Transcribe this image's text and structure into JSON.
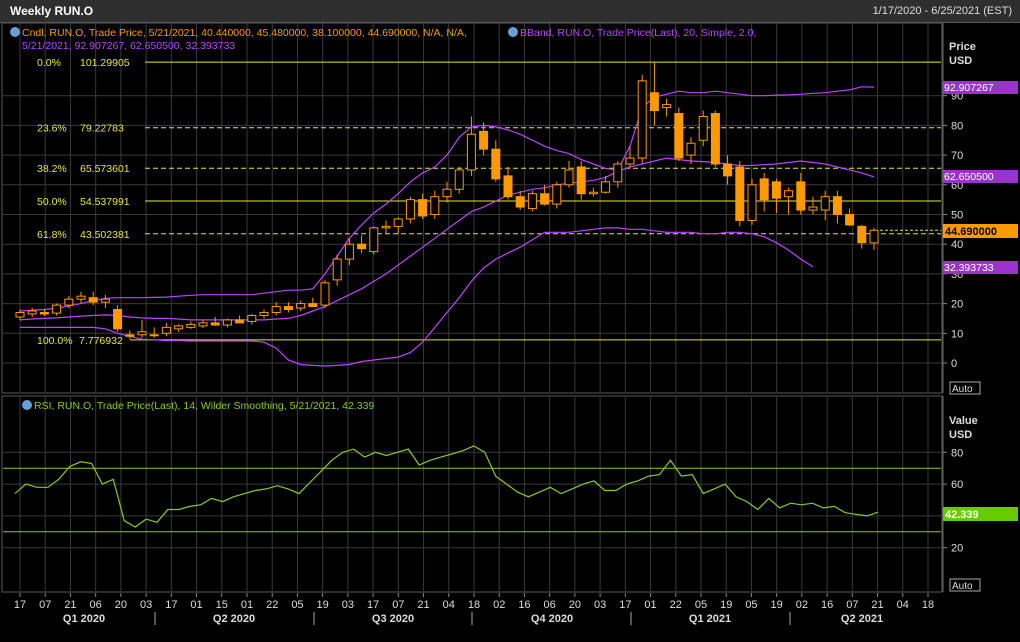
{
  "window": {
    "title": "Weekly RUN.O",
    "date_range": "1/17/2020 - 6/25/2021 (EST)"
  },
  "legend": {
    "candle_line": "Cndl, RUN.O, Trade Price,  5/21/2021, 40.440000, 45.480000, 38.100000, 44.690000, N/A, N/A,",
    "bband_line1": "BBand, RUN.O, Trade Price(Last),  20, Simple, 2.0,",
    "bband_line2": "5/21/2021, 92.907267, 62.650500, 32.393733",
    "rsi_line": "RSI, RUN.O, Trade Price(Last),  14, Wilder Smoothing,  5/21/2021, 42.339"
  },
  "price_axis": {
    "title1": "Price",
    "title2": "USD",
    "auto": "Auto"
  },
  "rsi_axis": {
    "title1": "Value",
    "title2": "USD",
    "auto": "Auto"
  },
  "badges": {
    "bb_upper": "92.907267",
    "bb_mid": "62.650500",
    "last": "44.690000",
    "bb_lower": "32.393733",
    "rsi": "42.339"
  },
  "colors": {
    "background": "#000000",
    "grid": "#3a3a3a",
    "candle": "#ff9900",
    "bband": "#bb44ff",
    "fib": "#e8e830",
    "rsi": "#88cc22"
  },
  "x_axis": {
    "day_ticks": [
      "17",
      "07",
      "21",
      "06",
      "20",
      "03",
      "17",
      "01",
      "15",
      "01",
      "22",
      "05",
      "19",
      "03",
      "17",
      "07",
      "21",
      "04",
      "18",
      "02",
      "16",
      "06",
      "20",
      "03",
      "17",
      "01",
      "22",
      "05",
      "19",
      "05",
      "19",
      "02",
      "16",
      "07",
      "21",
      "04",
      "18"
    ],
    "quarters": [
      "Q1 2020",
      "Q2 2020",
      "Q3 2020",
      "Q4 2020",
      "Q1 2021",
      "Q2 2021"
    ]
  },
  "chart_data": [
    {
      "type": "candlestick",
      "title": "Weekly RUN.O",
      "ylabel": "Price USD",
      "ylim": [
        -5,
        105
      ],
      "yticks": [
        0,
        10,
        20,
        30,
        40,
        50,
        60,
        70,
        80,
        90
      ],
      "fib_levels": [
        {
          "pct": "0.0%",
          "value": "101.29905",
          "v": 101.29905,
          "style": "solid"
        },
        {
          "pct": "23.6%",
          "value": "79.22783",
          "v": 79.22783,
          "style": "dashed"
        },
        {
          "pct": "38.2%",
          "value": "65.573601",
          "v": 65.573601,
          "style": "dashed"
        },
        {
          "pct": "50.0%",
          "value": "54.537991",
          "v": 54.537991,
          "style": "solid"
        },
        {
          "pct": "61.8%",
          "value": "43.502381",
          "v": 43.502381,
          "style": "dashed"
        },
        {
          "pct": "100.0%",
          "value": "7.776932",
          "v": 7.776932,
          "style": "solid"
        }
      ],
      "last_candle": {
        "date": "5/21/2021",
        "open": 40.44,
        "high": 45.48,
        "low": 38.1,
        "close": 44.69
      },
      "candles": [
        {
          "o": 15.5,
          "h": 18.0,
          "l": 14.5,
          "c": 17.0
        },
        {
          "o": 16.5,
          "h": 18.5,
          "l": 15.5,
          "c": 17.5
        },
        {
          "o": 17.0,
          "h": 18.2,
          "l": 15.8,
          "c": 16.5
        },
        {
          "o": 16.8,
          "h": 20.0,
          "l": 16.0,
          "c": 19.5
        },
        {
          "o": 19.5,
          "h": 22.5,
          "l": 18.5,
          "c": 21.5
        },
        {
          "o": 21.5,
          "h": 24.0,
          "l": 20.0,
          "c": 22.5
        },
        {
          "o": 22.0,
          "h": 24.0,
          "l": 19.5,
          "c": 20.5
        },
        {
          "o": 20.5,
          "h": 23.0,
          "l": 18.5,
          "c": 21.5
        },
        {
          "o": 18.0,
          "h": 19.5,
          "l": 10.5,
          "c": 11.5
        },
        {
          "o": 9.5,
          "h": 11.0,
          "l": 8.0,
          "c": 9.0
        },
        {
          "o": 9.5,
          "h": 14.5,
          "l": 8.5,
          "c": 10.5
        },
        {
          "o": 9.5,
          "h": 12.0,
          "l": 8.5,
          "c": 9.5
        },
        {
          "o": 10.0,
          "h": 13.5,
          "l": 9.0,
          "c": 12.0
        },
        {
          "o": 11.5,
          "h": 13.0,
          "l": 10.5,
          "c": 12.5
        },
        {
          "o": 12.0,
          "h": 14.0,
          "l": 11.5,
          "c": 13.0
        },
        {
          "o": 12.5,
          "h": 14.5,
          "l": 11.8,
          "c": 13.5
        },
        {
          "o": 13.5,
          "h": 15.5,
          "l": 12.5,
          "c": 12.8
        },
        {
          "o": 12.8,
          "h": 15.0,
          "l": 12.0,
          "c": 14.5
        },
        {
          "o": 14.5,
          "h": 16.0,
          "l": 13.5,
          "c": 13.5
        },
        {
          "o": 14.0,
          "h": 16.5,
          "l": 13.0,
          "c": 16.0
        },
        {
          "o": 16.0,
          "h": 18.0,
          "l": 15.0,
          "c": 17.0
        },
        {
          "o": 17.0,
          "h": 20.5,
          "l": 16.0,
          "c": 19.0
        },
        {
          "o": 19.0,
          "h": 20.5,
          "l": 17.0,
          "c": 18.0
        },
        {
          "o": 18.5,
          "h": 21.0,
          "l": 17.5,
          "c": 20.0
        },
        {
          "o": 20.0,
          "h": 22.0,
          "l": 19.0,
          "c": 19.0
        },
        {
          "o": 19.5,
          "h": 28.0,
          "l": 18.5,
          "c": 27.0
        },
        {
          "o": 28.0,
          "h": 36.5,
          "l": 26.0,
          "c": 35.0
        },
        {
          "o": 35.0,
          "h": 42.0,
          "l": 33.0,
          "c": 40.0
        },
        {
          "o": 40.0,
          "h": 43.0,
          "l": 37.0,
          "c": 38.5
        },
        {
          "o": 37.5,
          "h": 46.0,
          "l": 36.5,
          "c": 45.5
        },
        {
          "o": 45.5,
          "h": 48.0,
          "l": 43.5,
          "c": 46.0
        },
        {
          "o": 46.0,
          "h": 49.0,
          "l": 43.5,
          "c": 48.5
        },
        {
          "o": 48.5,
          "h": 56.0,
          "l": 47.0,
          "c": 55.0
        },
        {
          "o": 55.0,
          "h": 57.0,
          "l": 48.5,
          "c": 49.5
        },
        {
          "o": 50.0,
          "h": 58.0,
          "l": 48.5,
          "c": 56.0
        },
        {
          "o": 56.0,
          "h": 61.0,
          "l": 54.0,
          "c": 58.5
        },
        {
          "o": 58.5,
          "h": 66.0,
          "l": 57.0,
          "c": 65.0
        },
        {
          "o": 65.0,
          "h": 83.0,
          "l": 63.0,
          "c": 77.0
        },
        {
          "o": 78.0,
          "h": 81.0,
          "l": 70.0,
          "c": 72.0
        },
        {
          "o": 72.0,
          "h": 75.0,
          "l": 61.0,
          "c": 62.0
        },
        {
          "o": 63.0,
          "h": 66.0,
          "l": 55.0,
          "c": 56.0
        },
        {
          "o": 56.0,
          "h": 58.0,
          "l": 51.5,
          "c": 52.5
        },
        {
          "o": 52.0,
          "h": 58.0,
          "l": 51.0,
          "c": 57.0
        },
        {
          "o": 57.0,
          "h": 60.0,
          "l": 53.0,
          "c": 53.5
        },
        {
          "o": 53.5,
          "h": 61.0,
          "l": 52.0,
          "c": 60.0
        },
        {
          "o": 60.0,
          "h": 68.0,
          "l": 59.0,
          "c": 65.0
        },
        {
          "o": 66.0,
          "h": 68.0,
          "l": 55.0,
          "c": 57.0
        },
        {
          "o": 57.0,
          "h": 59.0,
          "l": 56.0,
          "c": 57.5
        },
        {
          "o": 57.5,
          "h": 63.0,
          "l": 57.0,
          "c": 61.0
        },
        {
          "o": 61.0,
          "h": 68.0,
          "l": 59.0,
          "c": 67.0
        },
        {
          "o": 67.0,
          "h": 73.0,
          "l": 66.0,
          "c": 69.0
        },
        {
          "o": 69.0,
          "h": 97.0,
          "l": 67.0,
          "c": 95.0
        },
        {
          "o": 91.0,
          "h": 101.3,
          "l": 80.0,
          "c": 85.0
        },
        {
          "o": 86.0,
          "h": 89.0,
          "l": 83.0,
          "c": 87.0
        },
        {
          "o": 84.0,
          "h": 86.0,
          "l": 68.0,
          "c": 69.0
        },
        {
          "o": 70.0,
          "h": 76.0,
          "l": 67.0,
          "c": 74.0
        },
        {
          "o": 75.0,
          "h": 85.0,
          "l": 73.0,
          "c": 83.0
        },
        {
          "o": 84.0,
          "h": 85.0,
          "l": 66.0,
          "c": 67.0
        },
        {
          "o": 67.0,
          "h": 70.0,
          "l": 60.0,
          "c": 63.0
        },
        {
          "o": 66.0,
          "h": 68.0,
          "l": 46.0,
          "c": 48.0
        },
        {
          "o": 48.0,
          "h": 62.0,
          "l": 46.5,
          "c": 60.0
        },
        {
          "o": 62.0,
          "h": 64.0,
          "l": 51.0,
          "c": 55.0
        },
        {
          "o": 61.0,
          "h": 62.0,
          "l": 50.5,
          "c": 55.5
        },
        {
          "o": 56.0,
          "h": 59.0,
          "l": 50.0,
          "c": 58.0
        },
        {
          "o": 61.0,
          "h": 64.0,
          "l": 50.0,
          "c": 51.5
        },
        {
          "o": 51.5,
          "h": 56.0,
          "l": 50.0,
          "c": 52.5
        },
        {
          "o": 51.5,
          "h": 58.0,
          "l": 48.0,
          "c": 56.0
        },
        {
          "o": 56.0,
          "h": 58.0,
          "l": 47.0,
          "c": 50.0
        },
        {
          "o": 50.0,
          "h": 52.0,
          "l": 46.0,
          "c": 46.5
        },
        {
          "o": 46.0,
          "h": 46.5,
          "l": 38.5,
          "c": 40.5
        },
        {
          "o": 40.44,
          "h": 45.48,
          "l": 38.1,
          "c": 44.69
        }
      ],
      "bb_upper": [
        17.5,
        17.8,
        18.0,
        18.5,
        19.2,
        20.0,
        21.0,
        21.8,
        22.0,
        22.0,
        22.0,
        22.1,
        22.2,
        22.5,
        22.8,
        23.0,
        23.0,
        23.0,
        23.0,
        23.0,
        23.5,
        24.0,
        24.5,
        24.5,
        25.0,
        30.0,
        36.0,
        42.0,
        46.5,
        50.5,
        53.5,
        57.0,
        61.0,
        64.0,
        66.0,
        70.0,
        76.0,
        79.5,
        80.0,
        79.5,
        78.5,
        77.0,
        75.0,
        73.0,
        71.5,
        70.5,
        68.5,
        67.0,
        65.5,
        65.0,
        73.0,
        86.0,
        89.5,
        90.5,
        91.5,
        91.0,
        91.0,
        91.5,
        91.0,
        90.5,
        90.0,
        90.0,
        90.2,
        90.3,
        90.5,
        90.8,
        91.0,
        91.5,
        92.0,
        93.0,
        92.9
      ],
      "bb_mid": [
        14.5,
        14.8,
        15.0,
        15.2,
        15.5,
        15.8,
        16.0,
        16.2,
        16.0,
        15.5,
        15.2,
        15.0,
        15.0,
        14.8,
        14.5,
        14.5,
        14.5,
        14.5,
        14.5,
        14.5,
        14.5,
        14.8,
        15.0,
        16.0,
        17.5,
        19.0,
        21.0,
        23.0,
        25.0,
        27.5,
        30.0,
        33.0,
        36.0,
        39.0,
        42.0,
        45.0,
        48.0,
        51.0,
        52.5,
        54.5,
        56.5,
        57.5,
        58.5,
        59.0,
        60.0,
        60.5,
        61.0,
        61.5,
        62.5,
        64.5,
        66.0,
        67.0,
        68.0,
        69.0,
        68.5,
        68.0,
        67.8,
        67.5,
        67.0,
        66.5,
        66.5,
        66.8,
        67.0,
        67.5,
        68.0,
        67.5,
        67.0,
        66.0,
        65.0,
        64.0,
        62.65
      ],
      "bb_lower": [
        12.0,
        12.0,
        12.0,
        12.0,
        12.0,
        12.0,
        12.0,
        11.5,
        10.0,
        9.0,
        8.0,
        7.8,
        7.5,
        7.5,
        7.4,
        7.4,
        7.4,
        7.4,
        7.4,
        7.4,
        7.0,
        5.0,
        1.0,
        -0.5,
        -0.8,
        -1.0,
        -0.8,
        -0.5,
        0.5,
        1.0,
        1.5,
        2.0,
        3.5,
        7.0,
        12.0,
        17.0,
        22.0,
        27.5,
        32.0,
        35.0,
        37.0,
        39.0,
        41.5,
        44.0,
        44.0,
        44.0,
        44.5,
        45.0,
        45.5,
        45.5,
        45.0,
        45.0,
        44.5,
        44.0,
        44.0,
        44.0,
        43.5,
        43.5,
        44.0,
        44.0,
        43.5,
        42.5,
        40.5,
        38.0,
        35.0,
        32.4
      ],
      "last_value": 44.69
    },
    {
      "type": "line",
      "title": "RSI, RUN.O, Trade Price(Last), 14, Wilder Smoothing",
      "ylabel": "Value USD",
      "ylim": [
        15,
        95
      ],
      "yticks": [
        20,
        40,
        60,
        80
      ],
      "reference_lines": [
        70,
        30
      ],
      "series": [
        {
          "name": "RSI",
          "values": [
            54,
            60,
            58,
            58,
            63,
            71,
            74,
            73,
            60,
            63,
            37,
            33,
            38,
            36,
            44,
            44,
            46,
            47,
            51,
            49,
            52,
            54,
            56,
            57,
            59,
            57,
            54,
            61,
            68,
            75,
            80,
            82,
            77,
            80,
            78,
            80,
            82,
            72,
            75,
            77,
            79,
            81,
            84,
            80,
            65,
            60,
            55,
            52,
            55,
            58,
            54,
            57,
            60,
            62,
            56,
            56,
            60,
            62,
            65,
            66,
            75,
            65,
            66,
            54,
            57,
            60,
            52,
            49,
            44,
            51,
            45,
            48,
            47,
            48,
            45,
            46,
            42,
            41,
            40,
            42.339
          ]
        }
      ]
    }
  ]
}
